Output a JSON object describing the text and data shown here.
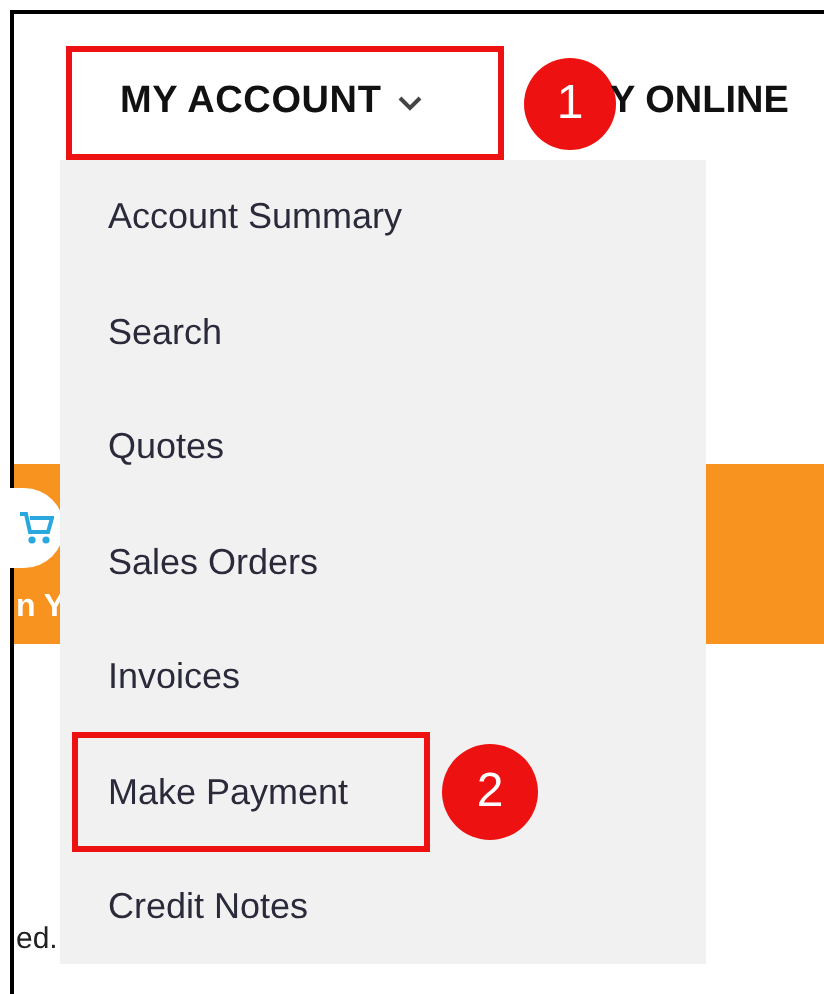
{
  "nav": {
    "account_menu": {
      "label": "MY ACCOUNT",
      "annotated": true,
      "callout": "1"
    },
    "next_item": "Y ONLINE"
  },
  "banner": {
    "text": "n Y"
  },
  "menu_items": [
    {
      "label": "Account Summary",
      "annotated": false
    },
    {
      "label": "Search",
      "annotated": false
    },
    {
      "label": "Quotes",
      "annotated": false
    },
    {
      "label": "Sales Orders",
      "annotated": false
    },
    {
      "label": "Invoices",
      "annotated": false
    },
    {
      "label": "Make Payment",
      "annotated": true,
      "callout": "2"
    },
    {
      "label": "Credit Notes",
      "annotated": false
    }
  ],
  "footer_text": "ed."
}
